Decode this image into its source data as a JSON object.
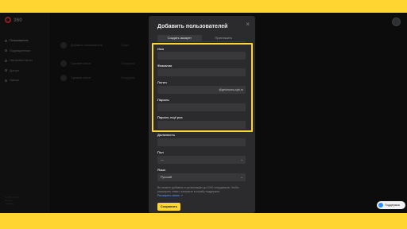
{
  "app": {
    "logo_text": "360"
  },
  "sidebar": {
    "items": [
      {
        "label": "Пользователи",
        "active": true
      },
      {
        "label": "Подразделения",
        "active": false
      },
      {
        "label": "Настройки почты",
        "active": false
      },
      {
        "label": "Доступ",
        "active": false
      },
      {
        "label": "Импорт",
        "active": false
      }
    ],
    "footer": [
      "© 2001-2023",
      "Яндекс",
      "Тарифы"
    ]
  },
  "main": {
    "add_users_label": "Добавить пользователя",
    "column_label": "Отдел",
    "rows": [
      {
        "name": "Сумаков Антон",
        "status": "Сотрудник"
      },
      {
        "name": "Сумаков Антон",
        "status": "Сотрудник"
      }
    ]
  },
  "modal": {
    "title": "Добавить пользователей",
    "tabs": [
      {
        "label": "Создать аккаунт",
        "active": true
      },
      {
        "label": "Пригласить",
        "active": false
      }
    ],
    "fields": {
      "first_name": {
        "label": "Имя",
        "value": ""
      },
      "last_name": {
        "label": "Фамилия",
        "value": ""
      },
      "login": {
        "label": "Логин",
        "value": "",
        "suffix": "@gelonomu-spb.ru"
      },
      "password": {
        "label": "Пароль",
        "value": ""
      },
      "password_repeat": {
        "label": "Пароль ещё раз",
        "value": ""
      },
      "position": {
        "label": "Должность",
        "value": ""
      },
      "gender": {
        "label": "Пол",
        "value": "—"
      },
      "language": {
        "label": "Язык",
        "value": "Русский"
      }
    },
    "hint": "Вы можете добавить в организацию до 1000 сотрудников. Чтобы расширить лимит, напишите в службу поддержки.",
    "hint_link": "Расширить лимит ↗",
    "save_label": "Сохранить"
  },
  "support": {
    "label": "Поддержка"
  },
  "colors": {
    "accent": "#ffd631",
    "background": "#161617",
    "modal": "#2b2b2d",
    "link": "#5b9dff"
  }
}
